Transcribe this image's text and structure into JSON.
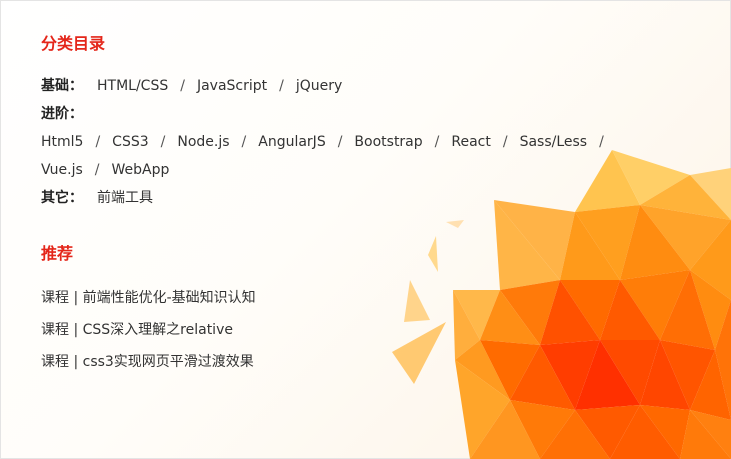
{
  "categories": {
    "title": "分类目录",
    "rows": [
      {
        "label": "基础：",
        "links": [
          "HTML/CSS",
          "JavaScript",
          "jQuery"
        ]
      },
      {
        "label": "进阶：",
        "links": [
          "Html5",
          "CSS3",
          "Node.js",
          "AngularJS",
          "Bootstrap",
          "React",
          "Sass/Less",
          "Vue.js",
          "WebApp"
        ]
      },
      {
        "label": "其它：",
        "links": [
          "前端工具"
        ]
      }
    ],
    "separator": "/"
  },
  "recommend": {
    "title": "推荐",
    "items": [
      "课程 | 前端性能优化-基础知识认知",
      "课程 | CSS深入理解之relative",
      "课程 | css3实现网页平滑过渡效果"
    ]
  },
  "colors": {
    "accent": "#e4261a",
    "polygon_orange": "#ff8a00",
    "polygon_red": "#ff3b00",
    "polygon_yellow": "#ffbf3a"
  }
}
